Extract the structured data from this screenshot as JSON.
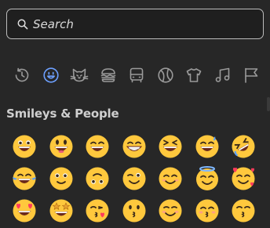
{
  "search": {
    "placeholder": "Search",
    "value": ""
  },
  "categories": [
    {
      "name": "recent",
      "icon": "clock-icon",
      "active": false
    },
    {
      "name": "smileys",
      "icon": "smiley-icon",
      "active": true
    },
    {
      "name": "animals",
      "icon": "cat-icon",
      "active": false
    },
    {
      "name": "food",
      "icon": "burger-icon",
      "active": false
    },
    {
      "name": "travel",
      "icon": "bus-icon",
      "active": false
    },
    {
      "name": "activities",
      "icon": "ball-icon",
      "active": false
    },
    {
      "name": "objects",
      "icon": "shirt-icon",
      "active": false
    },
    {
      "name": "symbols",
      "icon": "music-note-icon",
      "active": false
    },
    {
      "name": "flags",
      "icon": "flag-icon",
      "active": false
    }
  ],
  "colors": {
    "accent": "#6da0ff",
    "face": "#ffc83d",
    "background": "#272727"
  },
  "section": {
    "title": "Smileys & People"
  },
  "emojis": [
    "grinning-face",
    "grinning-face-big-eyes",
    "grinning-face-smiling-eyes",
    "beaming-face",
    "grinning-squinting-face",
    "grinning-face-sweat",
    "rolling-on-floor-laughing",
    "face-with-tears-of-joy",
    "slightly-smiling-face",
    "upside-down-face",
    "winking-face",
    "smiling-face-smiling-eyes",
    "smiling-face-halo",
    "smiling-face-hearts",
    "heart-eyes",
    "star-struck",
    "face-blowing-kiss",
    "kissing-face",
    "smiling-face",
    "kissing-face-closed-eyes",
    "kissing-face-smiling-eyes"
  ]
}
